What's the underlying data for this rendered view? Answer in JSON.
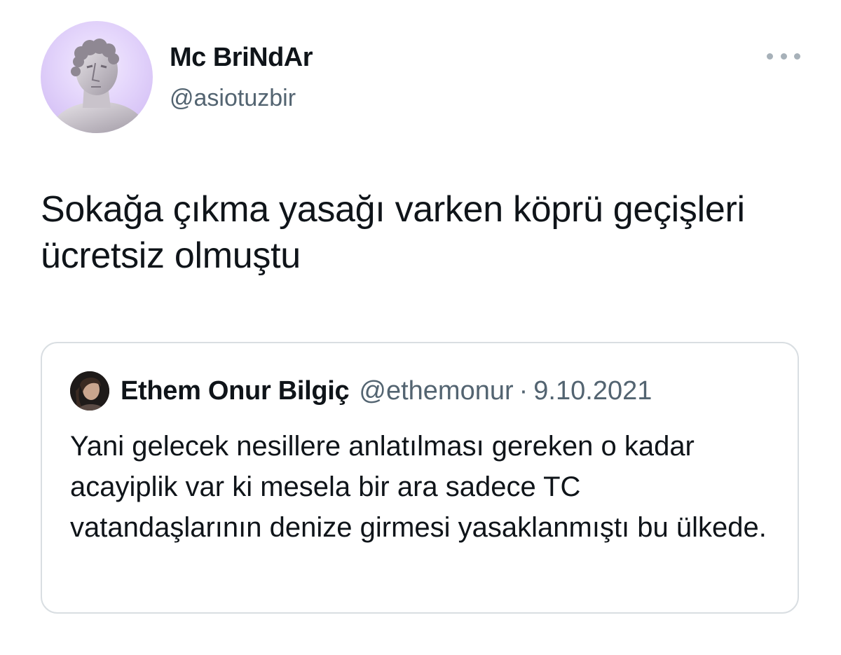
{
  "tweet": {
    "author": {
      "display_name": "Mc BriNdAr",
      "handle": "@asiotuzbir"
    },
    "more_icon": "more-horizontal-icon",
    "text": "Sokağa çıkma yasağı varken köprü geçişleri ücretsiz olmuştu"
  },
  "quoted_tweet": {
    "author": {
      "display_name": "Ethem Onur Bilgiç",
      "handle": "@ethemonur"
    },
    "separator": "·",
    "date": "9.10.2021",
    "text": "Yani gelecek nesillere anlatılması gereken o kadar acayiplik var ki mesela bir ara sadece TC vatandaşlarının denize girmesi yasaklanmıştı bu ülkede."
  },
  "colors": {
    "text_primary": "#0f1419",
    "text_secondary": "#536471",
    "border": "#d9dee2",
    "avatar_bg": "#e3d4fb"
  }
}
